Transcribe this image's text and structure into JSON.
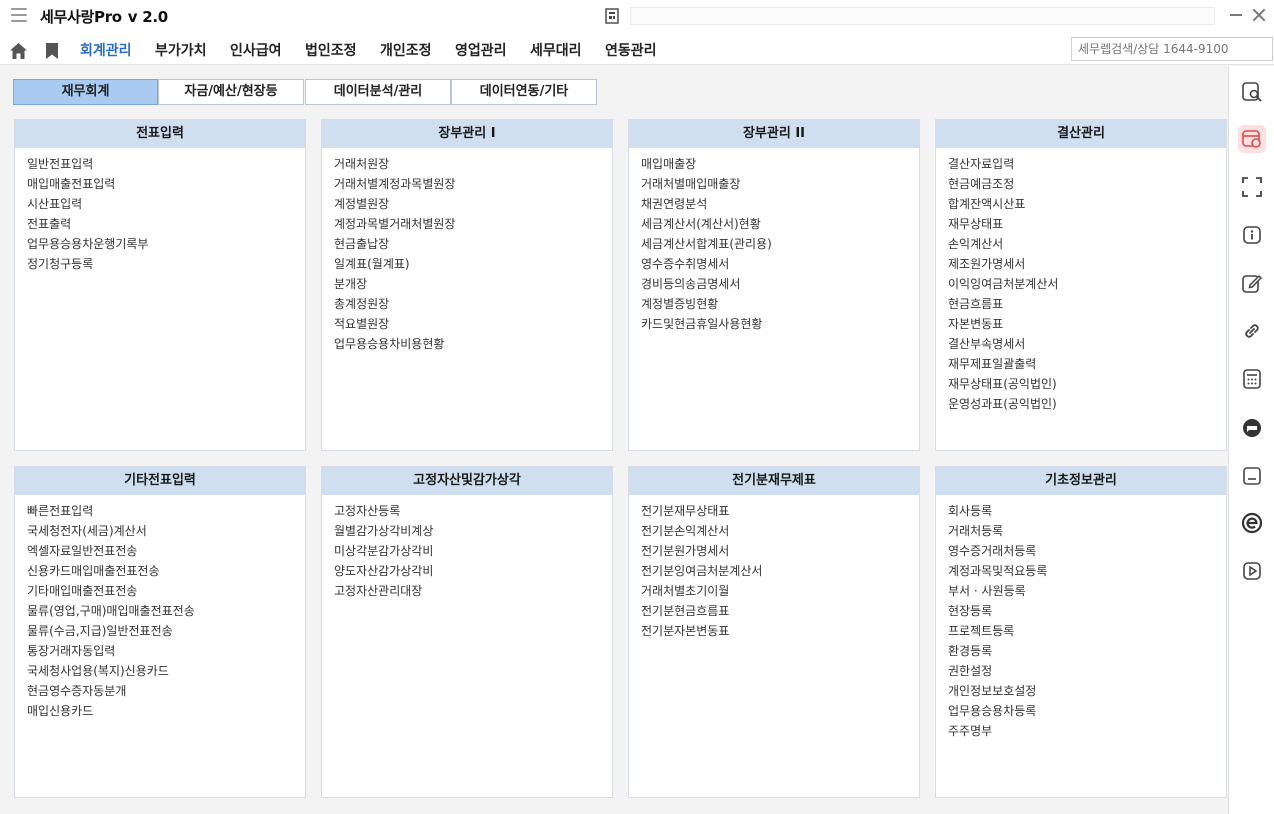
{
  "app": {
    "title": "세무사랑Pro",
    "version": "v 2.0"
  },
  "menu": {
    "items": [
      {
        "label": "회계관리"
      },
      {
        "label": "부가가치"
      },
      {
        "label": "인사급여"
      },
      {
        "label": "법인조정"
      },
      {
        "label": "개인조정"
      },
      {
        "label": "영업관리"
      },
      {
        "label": "세무대리"
      },
      {
        "label": "연동관리"
      }
    ],
    "search_placeholder": "세무렙검색/상담 1644-9100"
  },
  "tabs": [
    {
      "label": "재무회계"
    },
    {
      "label": "자금/예산/현장등"
    },
    {
      "label": "데이터분석/관리"
    },
    {
      "label": "데이터연동/기타"
    }
  ],
  "panels": [
    {
      "title": "전표입력",
      "items": [
        "일반전표입력",
        "매입매출전표입력",
        "시산표입력",
        "전표출력",
        "업무용승용차운행기록부",
        "정기청구등록"
      ]
    },
    {
      "title": "장부관리 I",
      "items": [
        "거래처원장",
        "거래처별계정과목별원장",
        "계정별원장",
        "계정과목별거래처별원장",
        "현금출납장",
        "일계표(월계표)",
        "분개장",
        "총계정원장",
        "적요별원장",
        "업무용승용차비용현황"
      ]
    },
    {
      "title": "장부관리 II",
      "items": [
        "매입매출장",
        "거래처별매입매출장",
        "채권연령분석",
        "세금계산서(계산서)현황",
        "세금계산서합계표(관리용)",
        "영수증수취명세서",
        "경비등의송금명세서",
        "계정별증빙현황",
        "카드및현금휴일사용현황"
      ]
    },
    {
      "title": "결산관리",
      "items": [
        "결산자료입력",
        "현금예금조정",
        "합계잔액시산표",
        "재무상태표",
        "손익계산서",
        "제조원가명세서",
        "이익잉여금처분계산서",
        "현금흐름표",
        "자본변동표",
        "결산부속명세서",
        "재무제표일괄출력",
        "재무상태표(공익법인)",
        "운영성과표(공익법인)"
      ]
    },
    {
      "title": "기타전표입력",
      "items": [
        "빠른전표입력",
        "국세청전자(세금)계산서",
        "엑셀자료일반전표전송",
        "신용카드매입매출전표전송",
        "기타매입매출전표전송",
        "물류(영업,구매)매입매출전표전송",
        "물류(수금,지급)일반전표전송",
        "통장거래자동입력",
        "국세청사업용(복지)신용카드",
        "현금영수증자동분개",
        "매입신용카드"
      ]
    },
    {
      "title": "고정자산및감가상각",
      "items": [
        "고정자산등록",
        "월별감가상각비계상",
        "미상각분감가상각비",
        "양도자산감가상각비",
        "고정자산관리대장"
      ]
    },
    {
      "title": "전기분재무제표",
      "items": [
        "전기분재무상태표",
        "전기분손익계산서",
        "전기분원가명세서",
        "전기분잉여금처분계산서",
        "거래처별초기이월",
        "전기분현금흐름표",
        "전기분자본변동표"
      ]
    },
    {
      "title": "기초정보관리",
      "items": [
        "회사등록",
        "거래처등록",
        "영수증거래처등록",
        "계정과목및적요등록",
        "부서 · 사원등록",
        "현장등록",
        "프로젝트등록",
        "환경등록",
        "권한설정",
        "개인정보보호설정",
        "업무용승용차등록",
        "주주명부"
      ]
    }
  ],
  "colors": {
    "accent": "#2a6dc6",
    "tab_active": "#a9cbf1",
    "panel_header": "#cfdff0",
    "sidebar_active": "#fde1e1",
    "sidebar_active_icon": "#e14b4b"
  },
  "sidebar_icons": [
    "search-doc-icon",
    "calendar-icon",
    "fullscreen-icon",
    "info-icon",
    "edit-icon",
    "link-icon",
    "calculator-icon",
    "chat-icon",
    "save-icon",
    "e-icon",
    "play-icon"
  ]
}
